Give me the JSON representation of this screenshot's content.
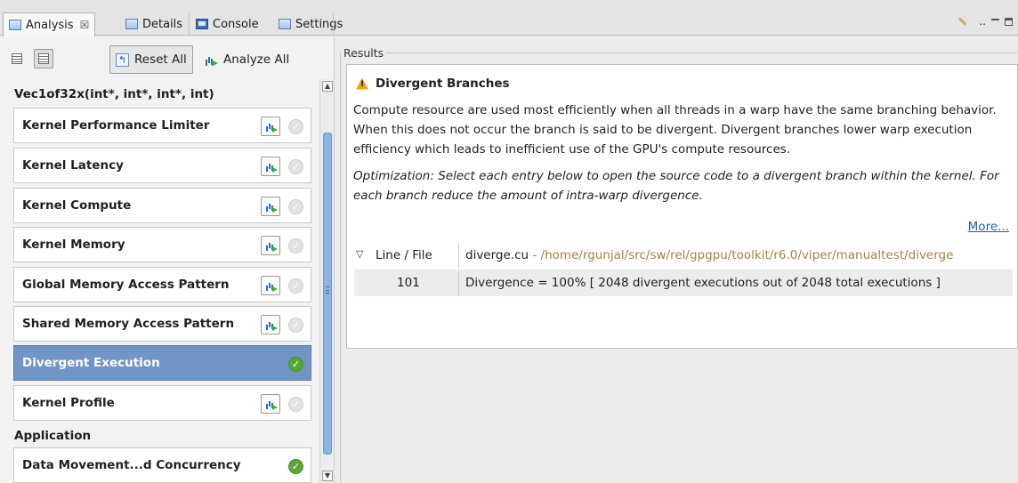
{
  "tabs": [
    {
      "label": "Analysis",
      "close": "☒",
      "icon": "analysis-view-icon"
    },
    {
      "label": "Details",
      "icon": "details-view-icon"
    },
    {
      "label": "Console",
      "icon": "console-view-icon"
    },
    {
      "label": "Settings",
      "icon": "settings-view-icon"
    }
  ],
  "window_controls": {
    "ellipsis": ".."
  },
  "toolbar": {
    "reset_all": "Reset All",
    "analyze_all": "Analyze All"
  },
  "kernel_group": {
    "title": "Vec1of32x(int*, int*, int*, int)",
    "items": [
      {
        "label": "Kernel Performance Limiter",
        "complete": false
      },
      {
        "label": "Kernel Latency",
        "complete": false
      },
      {
        "label": "Kernel Compute",
        "complete": false
      },
      {
        "label": "Kernel Memory",
        "complete": false
      },
      {
        "label": "Global Memory Access Pattern",
        "complete": false
      },
      {
        "label": "Shared Memory Access Pattern",
        "complete": false
      },
      {
        "label": "Divergent Execution",
        "complete": true,
        "selected": true
      },
      {
        "label": "Kernel Profile",
        "complete": false
      }
    ]
  },
  "application_group": {
    "title": "Application",
    "items": [
      {
        "label": "Data Movement...d Concurrency",
        "complete": true
      }
    ]
  },
  "results": {
    "label": "Results",
    "title": "Divergent Branches",
    "description": "Compute resource are used most efficiently when all threads in a warp have the same branching behavior. When this does not occur the branch is said to be divergent. Divergent branches lower warp execution efficiency which leads to inefficient use of the GPU's compute resources.",
    "optimization": "Optimization: Select each entry below to open the source code to a divergent branch within the kernel. For each branch reduce the amount of intra-warp divergence.",
    "more_link": "More...",
    "table": {
      "col_header": "Line / File",
      "file": "diverge.cu",
      "path": " - /home/rgunjal/src/sw/rel/gpgpu/toolkit/r6.0/viper/manualtest/diverge",
      "rows": [
        {
          "line": "101",
          "message": "Divergence = 100% [ 2048 divergent executions out of 2048 total executions ]"
        }
      ]
    }
  },
  "colors": {
    "selected_row": "#7195c4",
    "complete_check": "#5aa537",
    "path_text": "#a08449",
    "link": "#2a5db0"
  }
}
